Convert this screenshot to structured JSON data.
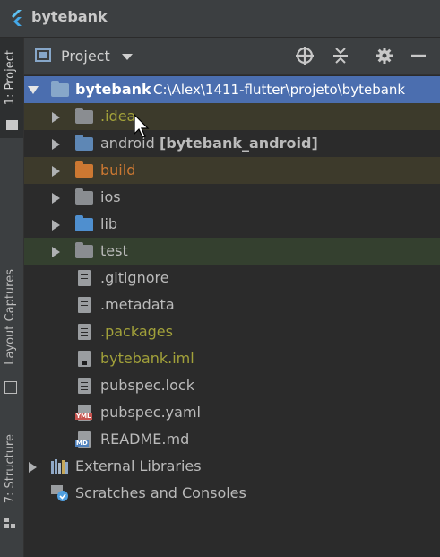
{
  "app": {
    "title": "bytebank"
  },
  "side_strip": {
    "project_tab": "1: Project",
    "layout_captures_tab": "Layout Captures",
    "structure_tab": "7: Structure"
  },
  "panel": {
    "title": "Project",
    "icons": [
      "crosshair-icon",
      "collapse-all-icon",
      "gear-icon",
      "minimize-icon"
    ]
  },
  "tree": {
    "root_name": "bytebank",
    "root_path": "C:\\Alex\\1411-flutter\\projeto\\bytebank",
    "items": [
      {
        "name": ".idea"
      },
      {
        "name": "android",
        "suffix": "[bytebank_android]"
      },
      {
        "name": "build"
      },
      {
        "name": "ios"
      },
      {
        "name": "lib"
      },
      {
        "name": "test"
      },
      {
        "name": ".gitignore"
      },
      {
        "name": ".metadata"
      },
      {
        "name": ".packages"
      },
      {
        "name": "bytebank.iml"
      },
      {
        "name": "pubspec.lock"
      },
      {
        "name": "pubspec.yaml",
        "badge": "YML"
      },
      {
        "name": "README.md",
        "badge": "MD"
      }
    ],
    "external_libraries": "External Libraries",
    "scratches": "Scratches and Consoles"
  },
  "colors": {
    "background": "#2b2b2b",
    "selection": "#4b6eaf",
    "folder_blue": "#5e87b5",
    "folder_gray": "#8a8d91",
    "excluded_orange": "#cc7832",
    "ignored_olive": "#a2a13a"
  }
}
